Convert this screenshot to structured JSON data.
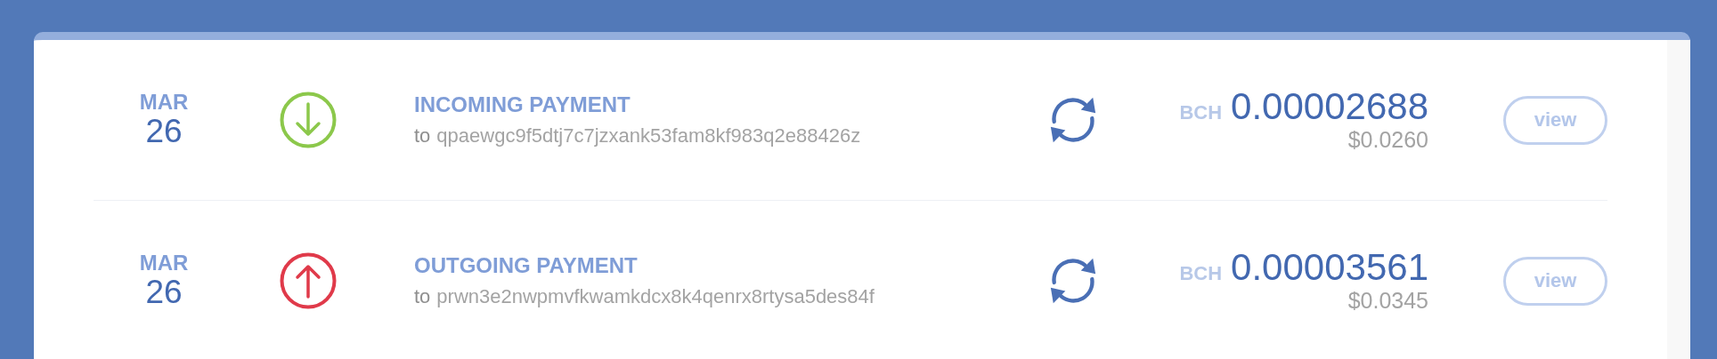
{
  "transactions": [
    {
      "month": "MAR",
      "day": "26",
      "kind": "incoming",
      "title": "INCOMING PAYMENT",
      "to_label": "to",
      "address": "qpaewgc9f5dtj7c7jzxank53fam8kf983q2e88426z",
      "currency": "BCH",
      "amount": "0.00002688",
      "fiat": "$0.0260",
      "button": "view"
    },
    {
      "month": "MAR",
      "day": "26",
      "kind": "outgoing",
      "title": "OUTGOING PAYMENT",
      "to_label": "to",
      "address": "prwn3e2nwpmvfkwamkdcx8k4qenrx8rtysa5des84f",
      "currency": "BCH",
      "amount": "0.00003561",
      "fiat": "$0.0345",
      "button": "view"
    }
  ]
}
